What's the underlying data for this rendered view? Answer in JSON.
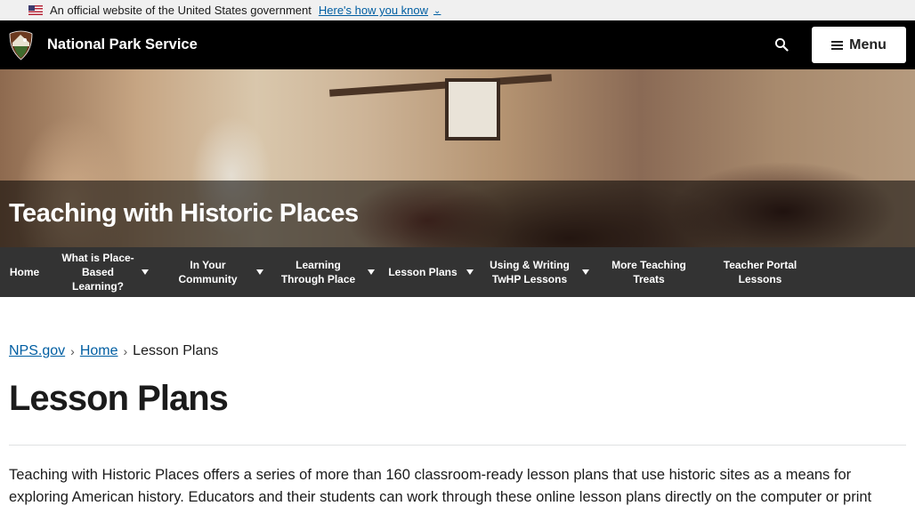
{
  "gov_banner": {
    "text": "An official website of the United States government",
    "link": "Here's how you know",
    "flag_icon": "us-flag-icon",
    "chevron_icon": "chevron-down-icon"
  },
  "header": {
    "site_name": "National Park Service",
    "logo_icon": "nps-arrowhead-icon",
    "search_icon": "search-icon",
    "menu_label": "Menu",
    "menu_icon": "hamburger-icon"
  },
  "hero": {
    "title": "Teaching with Historic Places"
  },
  "nav": {
    "items": [
      {
        "label": "Home",
        "has_dropdown": false
      },
      {
        "label": "What is Place-Based Learning?",
        "has_dropdown": true
      },
      {
        "label": "In Your Community",
        "has_dropdown": true
      },
      {
        "label": "Learning Through Place",
        "has_dropdown": true
      },
      {
        "label": "Lesson Plans",
        "has_dropdown": true
      },
      {
        "label": "Using & Writing TwHP Lessons",
        "has_dropdown": true
      },
      {
        "label": "More Teaching Treats",
        "has_dropdown": false
      },
      {
        "label": "Teacher Portal Lessons",
        "has_dropdown": false
      }
    ]
  },
  "breadcrumb": {
    "items": [
      "NPS.gov",
      "Home"
    ],
    "current": "Lesson Plans",
    "separator_icon": "chevron-right-icon"
  },
  "main": {
    "title": "Lesson Plans",
    "intro": "Teaching with Historic Places offers a series of more than 160 classroom-ready lesson plans that use historic sites as a means for exploring American history. Educators and their students can work through these online lesson plans directly on the computer or print"
  },
  "colors": {
    "link": "#005ea2",
    "header_bg": "#000000",
    "nav_bg": "#333333",
    "gov_banner_bg": "#f0f0f0"
  }
}
